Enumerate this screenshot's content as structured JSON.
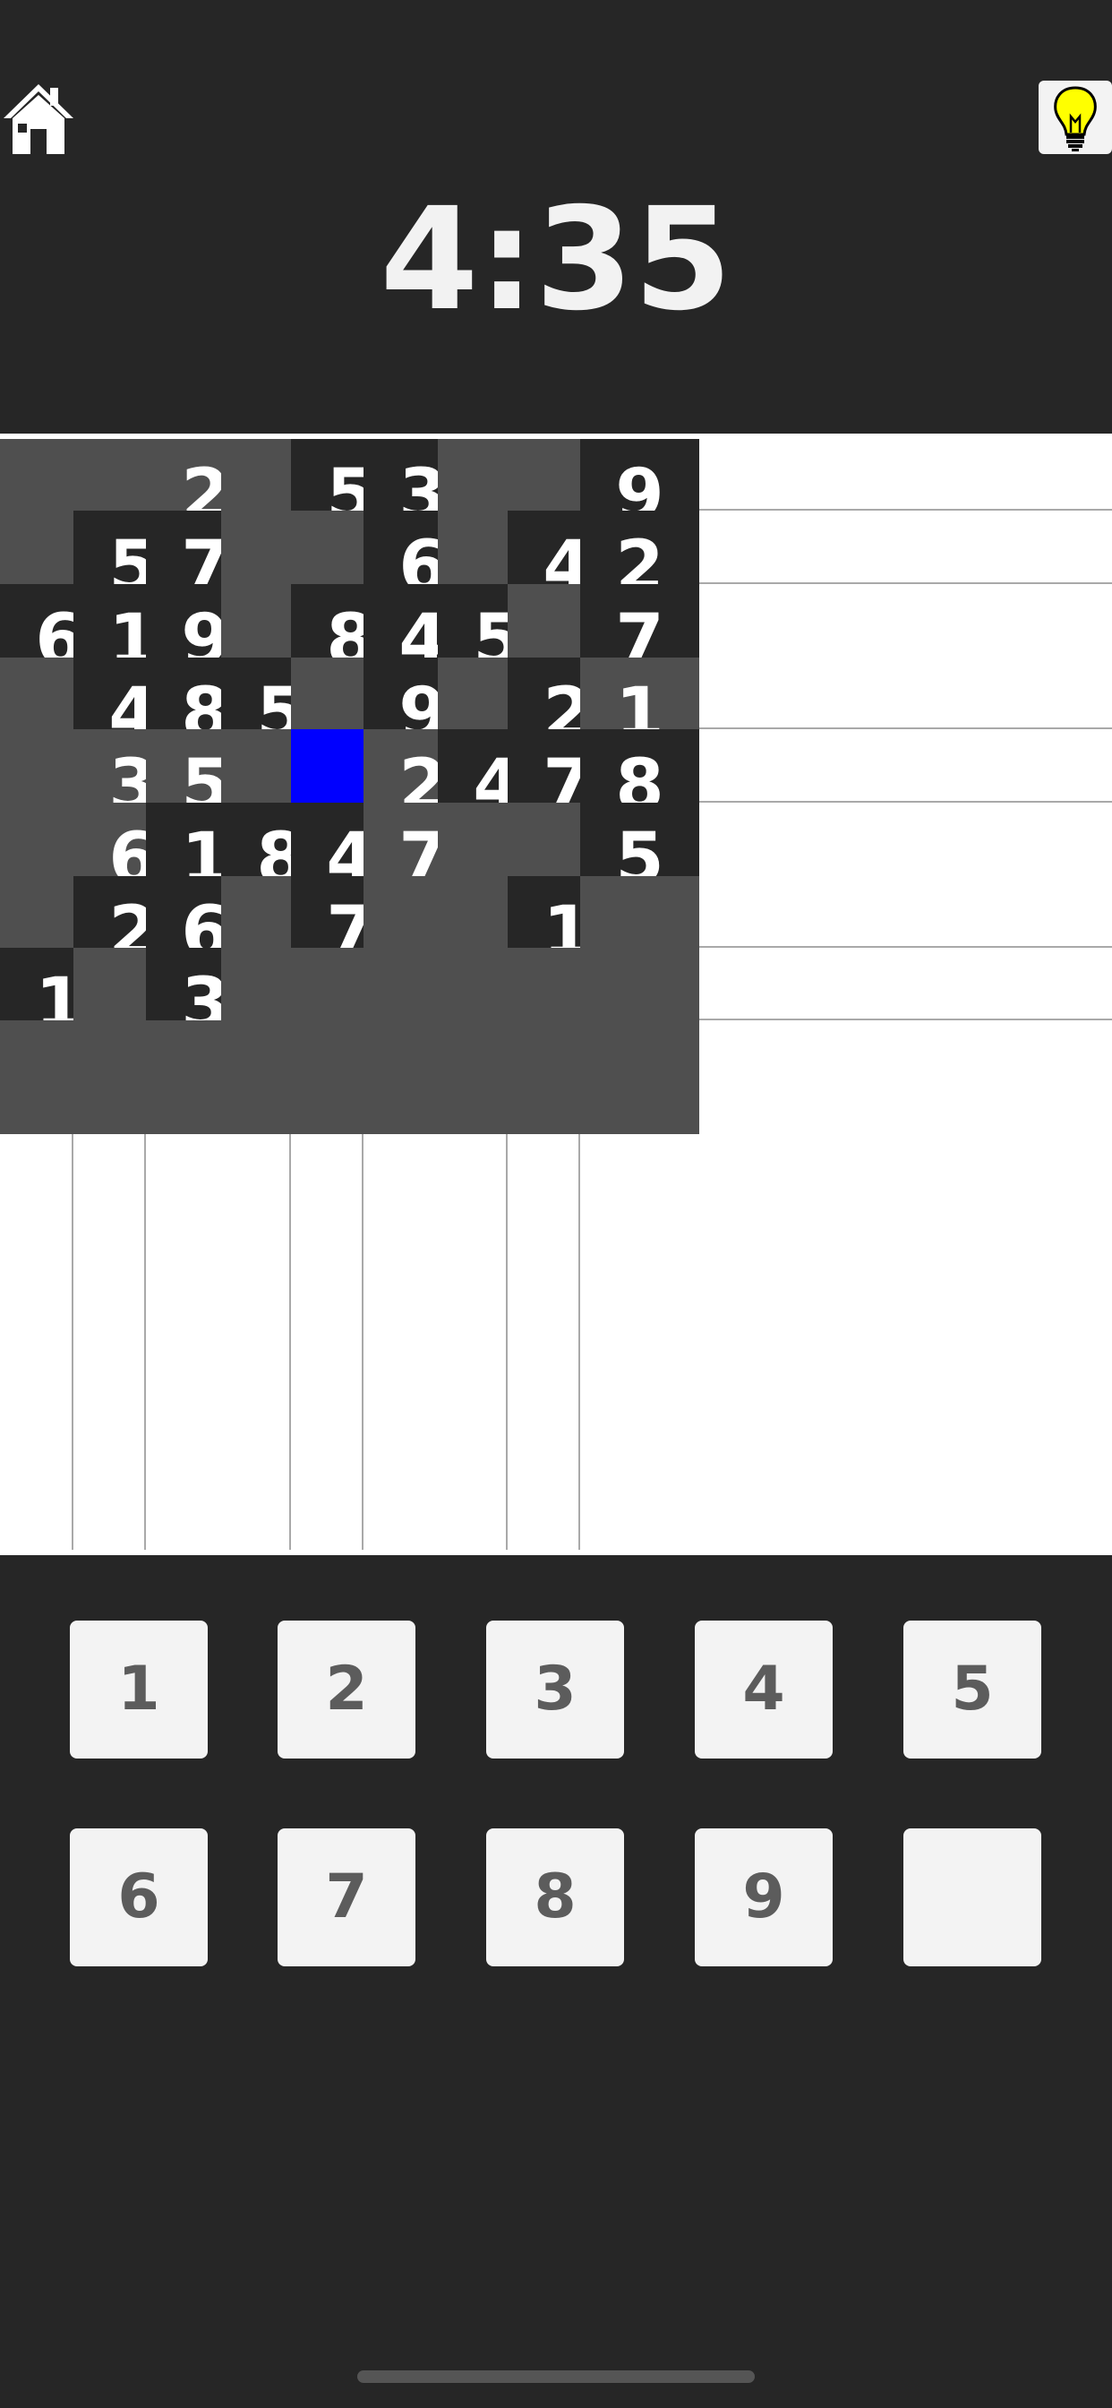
{
  "header": {
    "home_icon": "home-icon",
    "hint_icon": "lightbulb-icon",
    "timer": "4:35"
  },
  "colors": {
    "background": "#262626",
    "given_cell": "#262626",
    "empty_cell": "#4f4f4f",
    "selected_cell": "#0000ff",
    "box_border": "#ffffff",
    "cell_border": "#a9a9a9",
    "key_background": "#f3f3f3",
    "key_text": "#5c5c5c",
    "hint_bulb": "#ffff00"
  },
  "board": {
    "selected": [
      4,
      4
    ],
    "rows": [
      [
        "",
        "",
        "2",
        "",
        "5",
        "3",
        "",
        "",
        "9"
      ],
      [
        "",
        "5",
        "7",
        "",
        "",
        "6",
        "",
        "4",
        "2"
      ],
      [
        "6",
        "1",
        "9",
        "",
        "8",
        "4",
        "5",
        "",
        "7"
      ],
      [
        "",
        "4",
        "8",
        "5",
        "",
        "9",
        "",
        "2",
        "1"
      ],
      [
        "",
        "3",
        "5",
        "",
        "",
        "2",
        "4",
        "7",
        "8"
      ],
      [
        "",
        "6",
        "1",
        "8",
        "4",
        "7",
        "",
        "",
        "5"
      ],
      [
        "",
        "2",
        "6",
        "",
        "7",
        "",
        "",
        "1",
        ""
      ],
      [
        "1",
        "",
        "3",
        "",
        "",
        "",
        "",
        "",
        ""
      ],
      [
        "",
        "",
        "",
        "",
        "",
        "",
        "",
        "",
        ""
      ]
    ],
    "kinds": [
      [
        "e",
        "e",
        "u",
        "e",
        "g",
        "g",
        "e",
        "e",
        "g"
      ],
      [
        "e",
        "g",
        "g",
        "e",
        "e",
        "g",
        "e",
        "g",
        "g"
      ],
      [
        "g",
        "g",
        "g",
        "e",
        "g",
        "g",
        "g",
        "e",
        "g"
      ],
      [
        "e",
        "g",
        "g",
        "g",
        "e",
        "g",
        "e",
        "g",
        "u"
      ],
      [
        "e",
        "u",
        "u",
        "e",
        "s",
        "u",
        "g",
        "g",
        "g"
      ],
      [
        "e",
        "u",
        "g",
        "g",
        "g",
        "u",
        "e",
        "e",
        "g"
      ],
      [
        "e",
        "g",
        "g",
        "e",
        "g",
        "e",
        "e",
        "g",
        "e"
      ],
      [
        "g",
        "e",
        "g",
        "e",
        "e",
        "e",
        "e",
        "e",
        "e"
      ],
      [
        "e",
        "e",
        "e",
        "e",
        "e",
        "e",
        "e",
        "e",
        "e"
      ]
    ]
  },
  "keypad": {
    "keys": [
      "1",
      "2",
      "3",
      "4",
      "5",
      "6",
      "7",
      "8",
      "9",
      ""
    ],
    "erase_key_label": ""
  }
}
